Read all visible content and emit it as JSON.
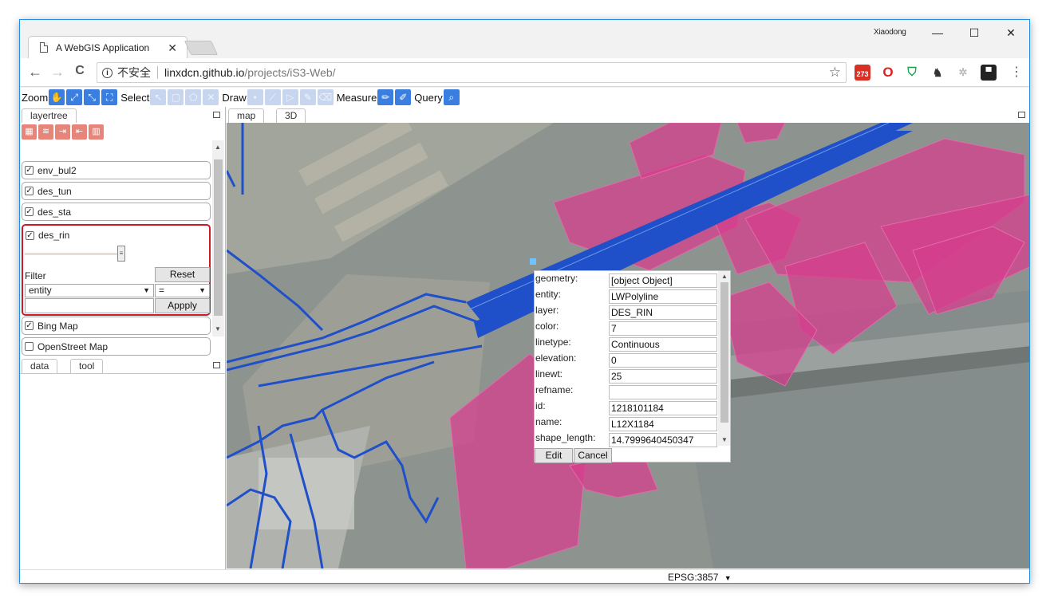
{
  "browser": {
    "tab_title": "A WebGIS Application",
    "tab_close": "✕",
    "user": "Xiaodong",
    "minimize": "—",
    "maximize": "☐",
    "close": "✕",
    "back": "←",
    "forward": "→",
    "reload": "C",
    "insecure_label": "不安全",
    "url_host": "linxdcn.github.io",
    "url_path": "/projects/iS3-Web/",
    "bookmark_star": "☆",
    "mail_badge": "273",
    "menu": "⋮"
  },
  "toolbar": {
    "zoom_label": "Zoom",
    "select_label": "Select",
    "draw_label": "Draw",
    "measure_label": "Measure",
    "query_label": "Query"
  },
  "left_panel": {
    "top_tab": "layertree",
    "bottom_tabs": [
      "data",
      "tool"
    ],
    "layers": [
      {
        "name": "env_bul2",
        "checked": true
      },
      {
        "name": "des_tun",
        "checked": true
      },
      {
        "name": "des_sta",
        "checked": true
      },
      {
        "name": "des_rin",
        "checked": true
      },
      {
        "name": "Bing Map",
        "checked": true
      },
      {
        "name": "OpenStreet Map",
        "checked": false
      }
    ],
    "filter": {
      "label": "Filter",
      "reset_label": "Reset",
      "field_value": "entity",
      "operator_value": "=",
      "apply_label": "Appply"
    }
  },
  "map_panel": {
    "tabs": [
      "map",
      "3D"
    ],
    "popup": {
      "attributes": [
        {
          "key": "geometry:",
          "value": "[object Object]"
        },
        {
          "key": "entity:",
          "value": "LWPolyline"
        },
        {
          "key": "layer:",
          "value": "DES_RIN"
        },
        {
          "key": "color:",
          "value": "7"
        },
        {
          "key": "linetype:",
          "value": "Continuous"
        },
        {
          "key": "elevation:",
          "value": "0"
        },
        {
          "key": "linewt:",
          "value": "25"
        },
        {
          "key": "refname:",
          "value": ""
        },
        {
          "key": "id:",
          "value": "1218101184"
        },
        {
          "key": "name:",
          "value": "L12X1184"
        },
        {
          "key": "shape_length:",
          "value": "14.7999640450347"
        }
      ],
      "edit_label": "Edit",
      "cancel_label": "Cancel"
    },
    "projection": "EPSG:3857",
    "colors": {
      "polygon_fill": "#d63f8e",
      "tunnel_line": "#1f4fc9",
      "map_background": "#8f9690"
    }
  }
}
